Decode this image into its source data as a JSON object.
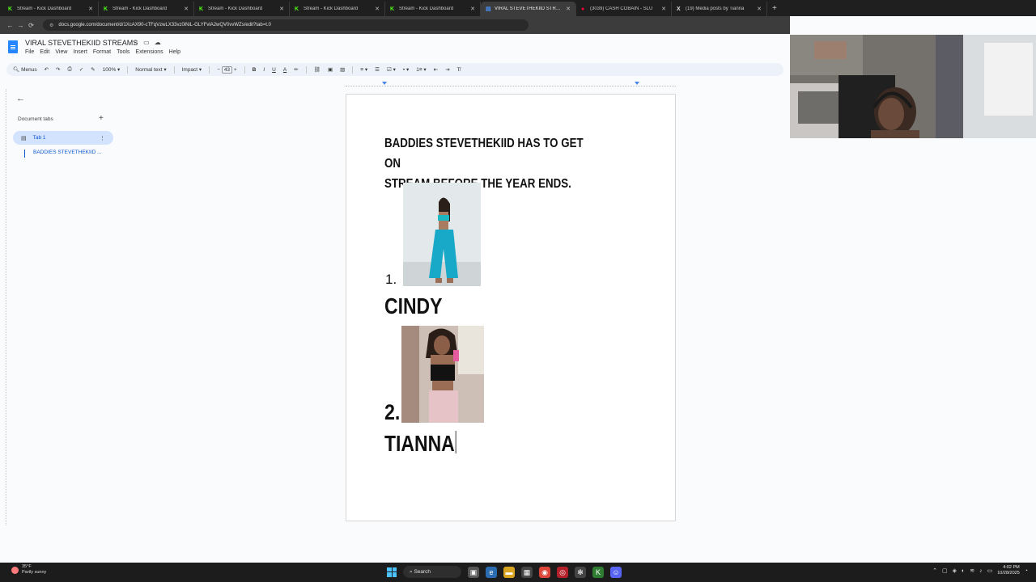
{
  "browser": {
    "tabs": [
      {
        "title": "Stream - Kick Dashboard",
        "icon": "kick-icon",
        "active": false
      },
      {
        "title": "Stream - Kick Dashboard",
        "icon": "kick-icon",
        "active": false
      },
      {
        "title": "Stream - Kick Dashboard",
        "icon": "kick-icon",
        "active": false
      },
      {
        "title": "Stream - Kick Dashboard",
        "icon": "kick-icon",
        "active": false
      },
      {
        "title": "Stream - Kick Dashboard",
        "icon": "kick-icon",
        "active": false
      },
      {
        "title": "VIRAL STEVETHEKIID STREAMS",
        "icon": "docs-icon",
        "active": true
      },
      {
        "title": "(3039) CASH COBAIN - SLU",
        "icon": "youtube-icon",
        "active": false
      },
      {
        "title": "(19) Media posts by Tianna",
        "icon": "x-icon",
        "active": false
      }
    ],
    "url": "docs.google.com/document/d/1XcAX90-cTFqVzwLX33vz0iNiL-GLYFvlA2wQV0vvWZs/edit?tab=t.0"
  },
  "docs": {
    "title": "VIRAL STEVETHEKIID STREAMS",
    "menu": [
      "File",
      "Edit",
      "View",
      "Insert",
      "Format",
      "Tools",
      "Extensions",
      "Help"
    ],
    "toolbar": {
      "menus_label": "Menus",
      "zoom": "100%",
      "style": "Normal text",
      "font": "Impact",
      "font_size": "43"
    }
  },
  "sidebar": {
    "document_tabs_label": "Document tabs",
    "tab1_label": "Tab 1",
    "outline_item": "BADDIES STEVETHEKIID ..."
  },
  "page": {
    "heading_line1": "BADDIES STEVETHEKIID HAS TO GET ON",
    "heading_line2": "STREAM BEFORE THE YEAR ENDS.",
    "item1_number": "1.",
    "item1_name": "CINDY",
    "item2_number": "2.",
    "item2_name": "TIANNA"
  },
  "taskbar": {
    "weather_temp": "35°F",
    "weather_desc": "Partly sunny",
    "search_label": "Search",
    "time": "4:02 PM",
    "date": "10/28/2025"
  },
  "colors": {
    "docs_blue": "#2684fc",
    "tab_highlight": "#d3e3fd",
    "accent_text": "#0b57d0"
  }
}
